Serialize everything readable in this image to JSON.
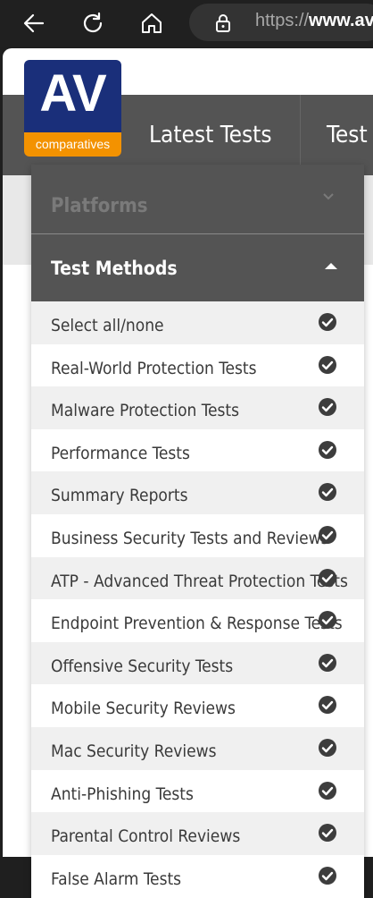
{
  "browser": {
    "url_prefix": "https://",
    "url_domain": "www.av"
  },
  "logo": {
    "main": "AV",
    "sub": "comparatives"
  },
  "nav": {
    "title": "Latest Tests",
    "next": "Test"
  },
  "filter": {
    "platforms_label": "Platforms",
    "methods_label": "Test Methods",
    "items": [
      {
        "label": "Select all/none",
        "checked": true
      },
      {
        "label": "Real-World Protection Tests",
        "checked": true
      },
      {
        "label": "Malware Protection Tests",
        "checked": true
      },
      {
        "label": "Performance Tests",
        "checked": true
      },
      {
        "label": "Summary Reports",
        "checked": true
      },
      {
        "label": "Business Security Tests and Reviews",
        "checked": true
      },
      {
        "label": "ATP - Advanced Threat Protection Tests",
        "checked": true
      },
      {
        "label": "Endpoint Prevention & Response Tests",
        "checked": true
      },
      {
        "label": "Offensive Security Tests",
        "checked": true
      },
      {
        "label": "Mobile Security Reviews",
        "checked": true
      },
      {
        "label": "Mac Security Reviews",
        "checked": true
      },
      {
        "label": "Anti-Phishing Tests",
        "checked": true
      },
      {
        "label": "Parental Control Reviews",
        "checked": true
      },
      {
        "label": "False Alarm Tests",
        "checked": true
      }
    ]
  },
  "colors": {
    "toolbar": "#202020",
    "nav_bg": "#545454",
    "logo_blue": "#1a2f7a",
    "logo_orange": "#f39200",
    "check": "#3d3d3d"
  },
  "icons": {
    "back": "back-arrow-icon",
    "refresh": "refresh-icon",
    "home": "home-icon",
    "lock": "lock-icon",
    "check": "check-circle-icon",
    "caret_up": "caret-up-icon",
    "chevron_down": "chevron-down-icon"
  }
}
